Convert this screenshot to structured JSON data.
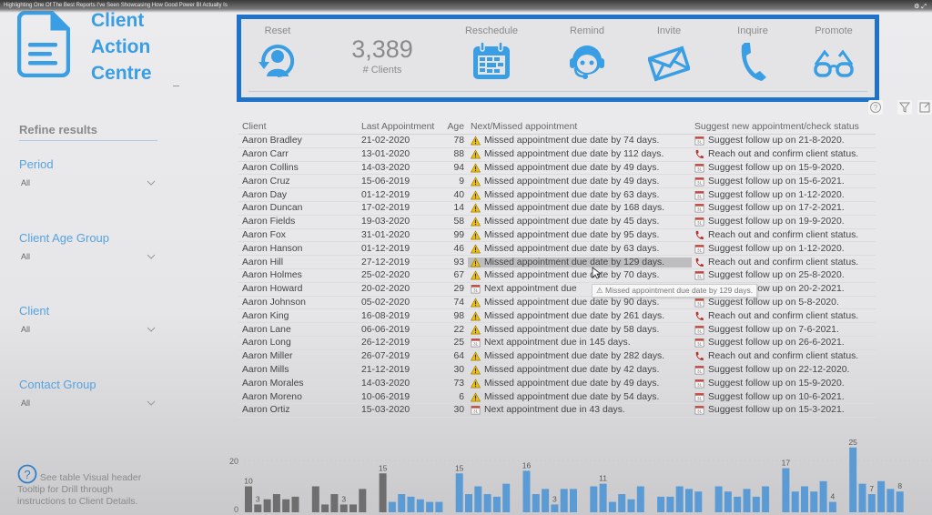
{
  "video": {
    "title": "Highlighting One Of The Best Reports I've Seen Showcasing How Good Power BI Actually Is"
  },
  "header": {
    "title_lines": [
      "Client",
      "Action",
      "Centre"
    ],
    "logo_icon": "document-icon"
  },
  "actions": {
    "reset": {
      "label": "Reset",
      "icon": "user-refresh-icon"
    },
    "kpi": {
      "value": "3,389",
      "caption": "# Clients"
    },
    "reschedule": {
      "label": "Reschedule",
      "icon": "calendar-icon"
    },
    "remind": {
      "label": "Remind",
      "icon": "headset-agent-icon"
    },
    "invite": {
      "label": "Invite",
      "icon": "envelope-icon"
    },
    "inquire": {
      "label": "Inquire",
      "icon": "phone-icon"
    },
    "promote": {
      "label": "Promote",
      "icon": "glasses-icon"
    }
  },
  "visual_header": {
    "help": "help-icon",
    "filter": "filter-icon",
    "focus": "focus-mode-icon"
  },
  "sidebar": {
    "heading": "Refine results",
    "filters": [
      {
        "label": "Period",
        "value": "All"
      },
      {
        "label": "Client Age Group",
        "value": "All"
      },
      {
        "label": "Client",
        "value": "All"
      },
      {
        "label": "Contact Group",
        "value": "All"
      }
    ],
    "help_note": "See table Visual header Tooltip for Drill through instructions to Client Details."
  },
  "table": {
    "columns": [
      "Client",
      "Last Appointment",
      "Age",
      "Next/Missed appointment",
      "Suggest new appointment/check status"
    ],
    "rows": [
      {
        "client": "Aaron Bradley",
        "last": "21-02-2020",
        "age": "78",
        "status_icon": "warning",
        "status": "Missed appointment due date by 74 days.",
        "suggest_icon": "calendar",
        "suggest": "Suggest follow up on 21-8-2020."
      },
      {
        "client": "Aaron Carr",
        "last": "13-01-2020",
        "age": "88",
        "status_icon": "warning",
        "status": "Missed appointment due date by 112 days.",
        "suggest_icon": "phone",
        "suggest": "Reach out and confirm client status."
      },
      {
        "client": "Aaron Collins",
        "last": "14-03-2020",
        "age": "94",
        "status_icon": "warning",
        "status": "Missed appointment due date by 49 days.",
        "suggest_icon": "calendar",
        "suggest": "Suggest follow up on 15-9-2020."
      },
      {
        "client": "Aaron Cruz",
        "last": "15-06-2019",
        "age": "9",
        "status_icon": "warning",
        "status": "Missed appointment due date by 49 days.",
        "suggest_icon": "calendar",
        "suggest": "Suggest follow up on 15-6-2021."
      },
      {
        "client": "Aaron Day",
        "last": "01-12-2019",
        "age": "40",
        "status_icon": "warning",
        "status": "Missed appointment due date by 63 days.",
        "suggest_icon": "calendar",
        "suggest": "Suggest follow up on 1-12-2020."
      },
      {
        "client": "Aaron Duncan",
        "last": "17-02-2019",
        "age": "14",
        "status_icon": "warning",
        "status": "Missed appointment due date by 168 days.",
        "suggest_icon": "calendar",
        "suggest": "Suggest follow up on 17-2-2021."
      },
      {
        "client": "Aaron Fields",
        "last": "19-03-2020",
        "age": "58",
        "status_icon": "warning",
        "status": "Missed appointment due date by 45 days.",
        "suggest_icon": "calendar",
        "suggest": "Suggest follow up on 19-9-2020."
      },
      {
        "client": "Aaron Fox",
        "last": "31-01-2020",
        "age": "99",
        "status_icon": "warning",
        "status": "Missed appointment due date by 95 days.",
        "suggest_icon": "phone",
        "suggest": "Reach out and confirm client status."
      },
      {
        "client": "Aaron Hanson",
        "last": "01-12-2019",
        "age": "46",
        "status_icon": "warning",
        "status": "Missed appointment due date by 63 days.",
        "suggest_icon": "calendar",
        "suggest": "Suggest follow up on 1-12-2020."
      },
      {
        "client": "Aaron Hill",
        "last": "27-12-2019",
        "age": "93",
        "status_icon": "warning",
        "status": "Missed appointment due date by 129 days.",
        "suggest_icon": "phone",
        "suggest": "Reach out and confirm client status.",
        "highlighted": true
      },
      {
        "client": "Aaron Holmes",
        "last": "25-02-2020",
        "age": "67",
        "status_icon": "warning",
        "status": "Missed appointment due date by 70 days.",
        "suggest_icon": "calendar",
        "suggest": "Suggest follow up on 25-8-2020."
      },
      {
        "client": "Aaron Howard",
        "last": "20-02-2020",
        "age": "29",
        "status_icon": "calendar",
        "status": "Next appointment due",
        "suggest_icon": "calendar",
        "suggest": "Suggest follow up on 20-2-2021."
      },
      {
        "client": "Aaron Johnson",
        "last": "05-02-2020",
        "age": "74",
        "status_icon": "warning",
        "status": "Missed appointment due date by 90 days.",
        "suggest_icon": "calendar",
        "suggest": "Suggest follow up on 5-8-2020."
      },
      {
        "client": "Aaron King",
        "last": "16-08-2019",
        "age": "98",
        "status_icon": "warning",
        "status": "Missed appointment due date by 261 days.",
        "suggest_icon": "phone",
        "suggest": "Reach out and confirm client status."
      },
      {
        "client": "Aaron Lane",
        "last": "06-06-2019",
        "age": "22",
        "status_icon": "warning",
        "status": "Missed appointment due date by 58 days.",
        "suggest_icon": "calendar",
        "suggest": "Suggest follow up on 7-6-2021."
      },
      {
        "client": "Aaron Long",
        "last": "26-12-2019",
        "age": "25",
        "status_icon": "calendar",
        "status": "Next appointment due in 145 days.",
        "suggest_icon": "calendar",
        "suggest": "Suggest follow up on 26-6-2021."
      },
      {
        "client": "Aaron Miller",
        "last": "26-07-2019",
        "age": "64",
        "status_icon": "warning",
        "status": "Missed appointment due date by 282 days.",
        "suggest_icon": "phone",
        "suggest": "Reach out and confirm client status."
      },
      {
        "client": "Aaron Mills",
        "last": "21-12-2019",
        "age": "30",
        "status_icon": "warning",
        "status": "Missed appointment due date by 42 days.",
        "suggest_icon": "calendar",
        "suggest": "Suggest follow up on 22-12-2020."
      },
      {
        "client": "Aaron Morales",
        "last": "14-03-2020",
        "age": "73",
        "status_icon": "warning",
        "status": "Missed appointment due date by 49 days.",
        "suggest_icon": "calendar",
        "suggest": "Suggest follow up on 15-9-2020."
      },
      {
        "client": "Aaron Moreno",
        "last": "10-06-2019",
        "age": "6",
        "status_icon": "warning",
        "status": "Missed appointment due date by 54 days.",
        "suggest_icon": "calendar",
        "suggest": "Suggest follow up on 10-6-2021."
      },
      {
        "client": "Aaron Ortiz",
        "last": "15-03-2020",
        "age": "30",
        "status_icon": "calendar",
        "status": "Next appointment due in 43 days.",
        "suggest_icon": "calendar",
        "suggest": "Suggest follow up on 15-3-2021."
      }
    ],
    "tooltip": "Missed appointment due date by 129 days."
  },
  "colors": {
    "accent": "#3a9ee4",
    "frame": "#1f72c9",
    "bar_blue": "#5b9bd5",
    "bar_gray": "#6e6e6e",
    "warning": "#f2c200",
    "phone": "#b5332a"
  },
  "chart_data": {
    "type": "bar",
    "ylim": [
      0,
      25
    ],
    "yticks": [
      "0",
      "20"
    ],
    "groups": [
      {
        "color": "gray",
        "values": [
          10,
          3,
          5,
          7,
          5,
          6
        ]
      },
      {
        "color": "gray",
        "values": [
          10,
          3,
          7,
          3,
          3,
          9
        ]
      },
      {
        "color": "mixed",
        "values": [
          15,
          4,
          7,
          6,
          5,
          4,
          4
        ]
      },
      {
        "color": "blue",
        "values": [
          15,
          7,
          10,
          7,
          6,
          11
        ]
      },
      {
        "color": "blue",
        "values": [
          16,
          7,
          9,
          3,
          9,
          9
        ]
      },
      {
        "color": "blue",
        "values": [
          10,
          11,
          4,
          7,
          5,
          10
        ]
      },
      {
        "color": "blue",
        "values": [
          6,
          6,
          10,
          9,
          8
        ]
      },
      {
        "color": "blue",
        "values": [
          10,
          8,
          6,
          9,
          6,
          10
        ]
      },
      {
        "color": "blue",
        "values": [
          17,
          8,
          10,
          8,
          12,
          4
        ]
      },
      {
        "color": "blue",
        "values": [
          25,
          11,
          7,
          12,
          9,
          8
        ]
      }
    ],
    "data_labels": {
      "0.0": "10",
      "0.1": "3",
      "1.3": "3",
      "2.0": "15",
      "3.0": "15",
      "4.0": "16",
      "4.3": "3",
      "5.1": "11",
      "8.0": "17",
      "8.5": "4",
      "9.0": "25",
      "9.2": "7",
      "9.5": "8"
    }
  }
}
